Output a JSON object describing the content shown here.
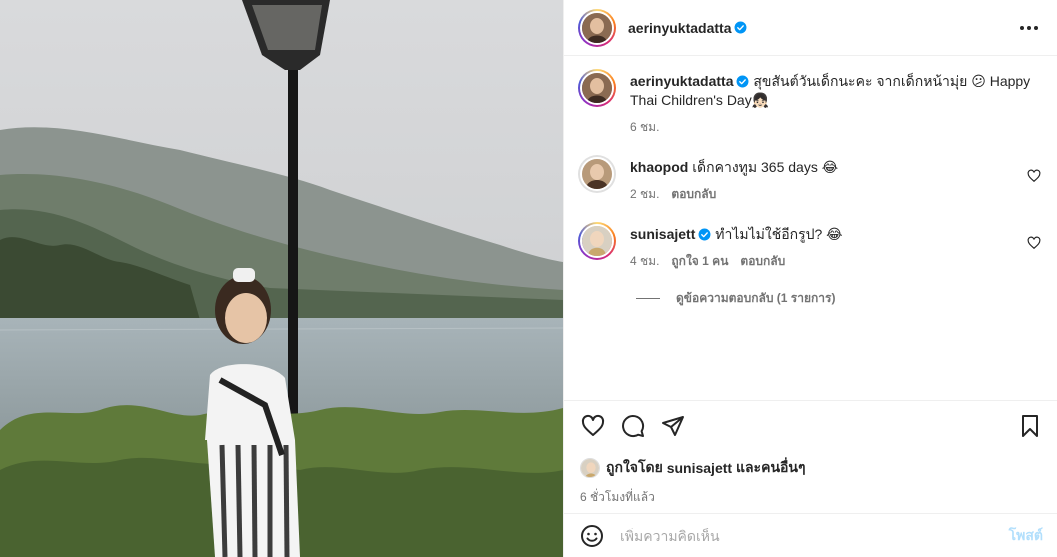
{
  "post": {
    "author": "aerinyuktadatta",
    "verified": true,
    "photo_alt": "child standing by a lake with lamp post"
  },
  "header": {
    "username": "aerinyuktadatta",
    "more_icon": "more-horizontal-icon"
  },
  "caption": {
    "username": "aerinyuktadatta",
    "text": "สุขสันต์วันเด็กนะคะ จากเด็กหน้ามุ่ย 😕 Happy Thai Children's Day👧🏻",
    "time": "6 ชม."
  },
  "comments": [
    {
      "username": "khaopod",
      "verified": false,
      "text": "เด็กคางทูม 365 days 😂",
      "time": "2 ชม.",
      "likes": "",
      "reply": "ตอบกลับ"
    },
    {
      "username": "sunisajett",
      "verified": true,
      "text": "ทำไมไม่ใช้อีกรูป? 😂",
      "time": "4 ชม.",
      "likes": "ถูกใจ 1 คน",
      "reply": "ตอบกลับ"
    }
  ],
  "view_replies": "ดูข้อความตอบกลับ (1 รายการ)",
  "actions": {
    "like_icon": "heart-icon",
    "comment_icon": "comment-icon",
    "share_icon": "send-icon",
    "save_icon": "bookmark-icon"
  },
  "liked_by": {
    "prefix": "ถูกใจโดย ",
    "user": "sunisajett",
    "suffix": " และคนอื่นๆ"
  },
  "time_ago": "6 ชั่วโมงที่แล้ว",
  "add_comment": {
    "placeholder": "เพิ่มความคิดเห็น",
    "post_label": "โพสต์",
    "emoji_icon": "smiley-icon"
  },
  "colors": {
    "verified": "#0095f6",
    "post_disabled": "#b2dffc",
    "secondary_text": "#737373"
  }
}
